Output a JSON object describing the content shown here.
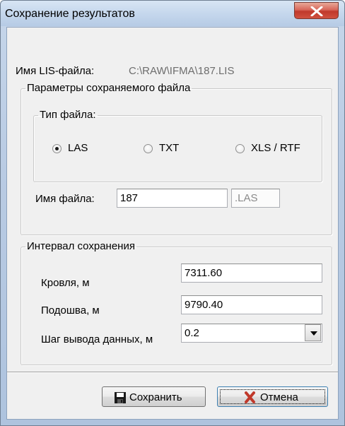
{
  "window": {
    "title": "Сохранение результатов"
  },
  "lis_file": {
    "label": "Имя LIS-файла:",
    "path": "C:\\RAW\\IFMA\\187.LIS"
  },
  "params_group": {
    "legend": "Параметры сохраняемого файла",
    "file_type": {
      "legend": "Тип файла:",
      "options": [
        "LAS",
        "TXT",
        "XLS / RTF"
      ],
      "selected": "LAS"
    },
    "filename": {
      "label": "Имя файла:",
      "value": "187",
      "extension": ".LAS"
    }
  },
  "interval_group": {
    "legend": "Интервал сохранения",
    "top": {
      "label": "Кровля, м",
      "value": "7311.60"
    },
    "bottom": {
      "label": "Подошва, м",
      "value": "9790.40"
    },
    "step": {
      "label": "Шаг вывода данных, м",
      "value": "0.2"
    }
  },
  "buttons": {
    "save": "Сохранить",
    "cancel": "Отмена"
  },
  "colors": {
    "close_button": "#c0392b",
    "cancel_icon": "#c0392b"
  }
}
